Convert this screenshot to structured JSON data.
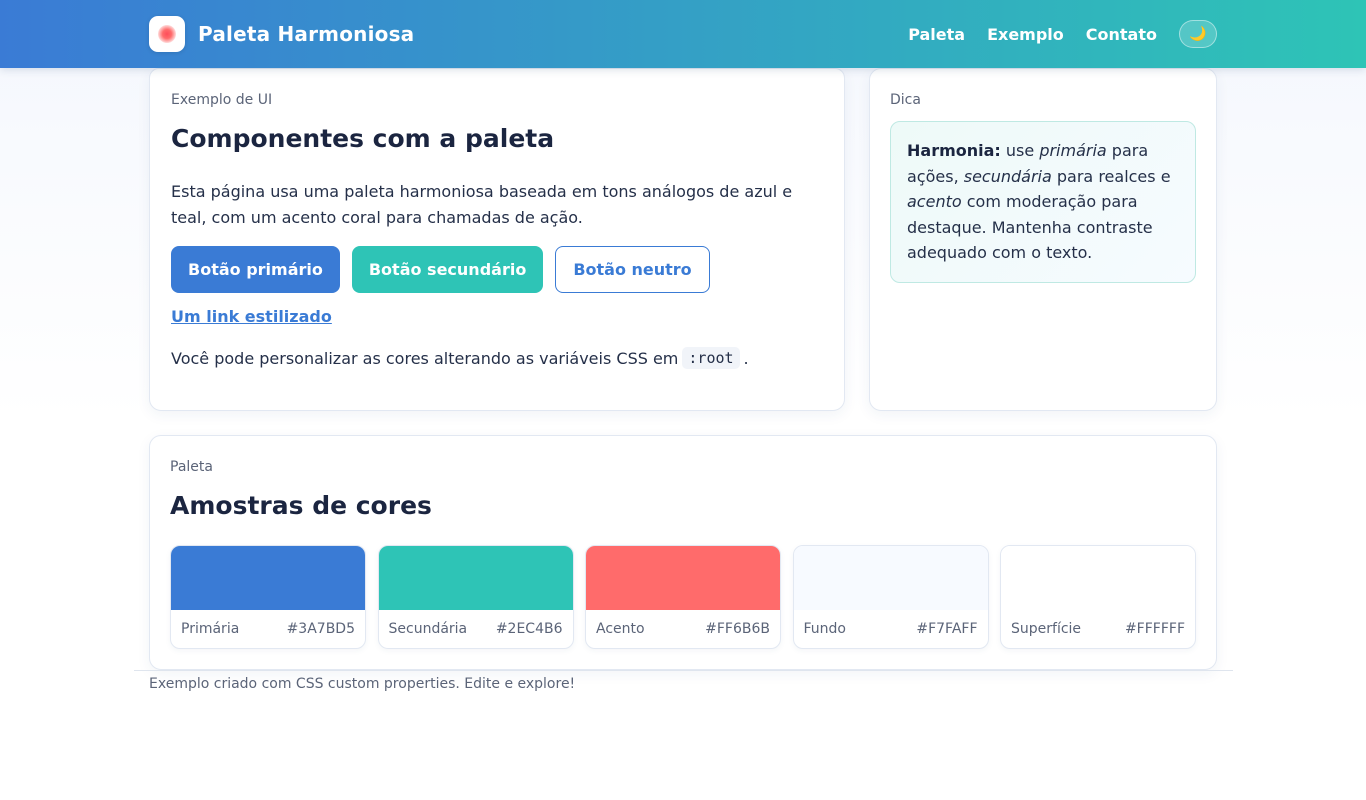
{
  "header": {
    "brand": "Paleta Harmoniosa",
    "nav": [
      "Paleta",
      "Exemplo",
      "Contato"
    ],
    "theme_icon": "moon-icon",
    "theme_glyph": "🌙"
  },
  "example": {
    "eyebrow": "Exemplo de UI",
    "title": "Componentes com a paleta",
    "intro": "Esta página usa uma paleta harmoniosa baseada em tons análogos de azul e teal, com um acento coral para chamadas de ação.",
    "buttons": {
      "primary": "Botão primário",
      "secondary": "Botão secundário",
      "neutral": "Botão neutro"
    },
    "link": "Um link estilizado",
    "note_before": "Você pode personalizar as cores alterando as variáveis CSS em",
    "note_code": ":root",
    "note_after": "."
  },
  "tip": {
    "eyebrow": "Dica",
    "strong": "Harmonia:",
    "t1": " use ",
    "e1": "primária",
    "t2": " para ações, ",
    "e2": "secundária",
    "t3": " para realces e ",
    "e3": "acento",
    "t4": " com moderação para destaque. Mantenha contraste adequado com o texto."
  },
  "palette": {
    "eyebrow": "Paleta",
    "title": "Amostras de cores",
    "swatches": [
      {
        "name": "Primária",
        "hex": "#3A7BD5"
      },
      {
        "name": "Secundária",
        "hex": "#2EC4B6"
      },
      {
        "name": "Acento",
        "hex": "#FF6B6B"
      },
      {
        "name": "Fundo",
        "hex": "#F7FAFF"
      },
      {
        "name": "Superfície",
        "hex": "#FFFFFF"
      }
    ]
  },
  "footer": "Exemplo criado com CSS custom properties. Edite e explore!"
}
